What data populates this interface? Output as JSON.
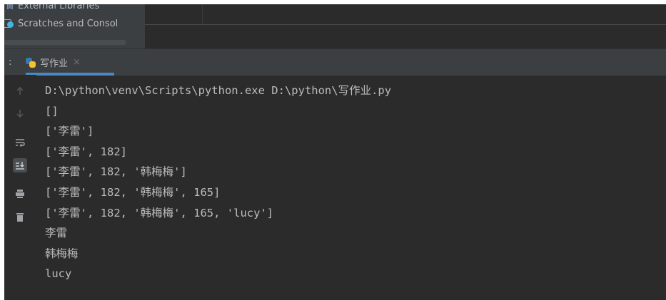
{
  "project_tree": {
    "items": [
      {
        "label": "External Libraries",
        "icon": "library-icon"
      },
      {
        "label": "Scratches and Consol",
        "icon": "scratch-icon"
      }
    ]
  },
  "run_panel": {
    "label": ":",
    "tab": {
      "title": "写作业",
      "close": "×",
      "icon": "python-icon"
    }
  },
  "gutter_icons": [
    "up-arrow-icon",
    "down-arrow-icon",
    "soft-wrap-icon",
    "scroll-to-end-icon",
    "print-icon",
    "trash-icon"
  ],
  "console": {
    "lines": [
      "D:\\python\\venv\\Scripts\\python.exe D:\\python\\写作业.py",
      "[]",
      "['李雷']",
      "['李雷', 182]",
      "['李雷', 182, '韩梅梅']",
      "['李雷', 182, '韩梅梅', 165]",
      "['李雷', 182, '韩梅梅', 165, 'lucy']",
      "李雷",
      "韩梅梅",
      "lucy"
    ]
  }
}
